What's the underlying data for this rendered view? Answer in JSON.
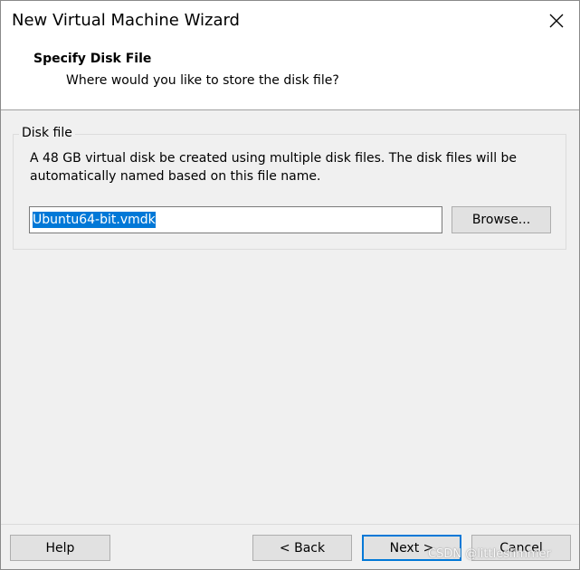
{
  "window": {
    "title": "New Virtual Machine Wizard"
  },
  "header": {
    "title": "Specify Disk File",
    "subtitle": "Where would you like to store the disk file?"
  },
  "disk_file": {
    "group_label": "Disk file",
    "description_line1": "A 48 GB virtual disk be created using multiple disk files. The disk files will be",
    "description_line2": "automatically named based on this file name.",
    "file_name_value": "Ubuntu64-bit.vmdk",
    "browse_label": "Browse..."
  },
  "footer": {
    "help_label": "Help",
    "back_label": "< Back",
    "next_label": "Next >",
    "cancel_label": "Cancel"
  },
  "watermark": "CSDN @littleslimmer",
  "colors": {
    "selection": "#0078d7",
    "button_face": "#e1e1e1",
    "dialog_bg": "#f0f0f0",
    "header_bg": "#ffffff"
  }
}
